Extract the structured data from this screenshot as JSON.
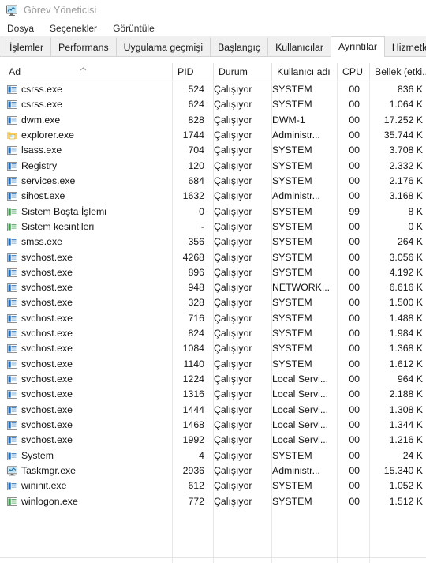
{
  "window": {
    "title": "Görev Yöneticisi",
    "icon": "taskmgr-chart-icon"
  },
  "menubar": {
    "items": [
      {
        "label": "Dosya"
      },
      {
        "label": "Seçenekler"
      },
      {
        "label": "Görüntüle"
      }
    ]
  },
  "tabs": [
    {
      "label": "İşlemler",
      "active": false
    },
    {
      "label": "Performans",
      "active": false
    },
    {
      "label": "Uygulama geçmişi",
      "active": false
    },
    {
      "label": "Başlangıç",
      "active": false
    },
    {
      "label": "Kullanıcılar",
      "active": false
    },
    {
      "label": "Ayrıntılar",
      "active": true
    },
    {
      "label": "Hizmetler",
      "active": false
    }
  ],
  "table": {
    "sort": {
      "column": "Ad",
      "direction": "ascending",
      "icon": "chevron-up-icon"
    },
    "columns": [
      {
        "key": "name",
        "label": "Ad",
        "align": "left"
      },
      {
        "key": "pid",
        "label": "PID",
        "align": "right"
      },
      {
        "key": "status",
        "label": "Durum",
        "align": "left"
      },
      {
        "key": "user",
        "label": "Kullanıcı adı",
        "align": "left"
      },
      {
        "key": "cpu",
        "label": "CPU",
        "align": "right"
      },
      {
        "key": "memory",
        "label": "Bellek (etki...",
        "align": "right"
      }
    ],
    "rows": [
      {
        "name": "csrss.exe",
        "pid": "524",
        "status": "Çalışıyor",
        "user": "SYSTEM",
        "cpu": "00",
        "memory": "836 K",
        "icon": "app-icon"
      },
      {
        "name": "csrss.exe",
        "pid": "624",
        "status": "Çalışıyor",
        "user": "SYSTEM",
        "cpu": "00",
        "memory": "1.064 K",
        "icon": "app-icon"
      },
      {
        "name": "dwm.exe",
        "pid": "828",
        "status": "Çalışıyor",
        "user": "DWM-1",
        "cpu": "00",
        "memory": "17.252 K",
        "icon": "app-icon"
      },
      {
        "name": "explorer.exe",
        "pid": "1744",
        "status": "Çalışıyor",
        "user": "Administr...",
        "cpu": "00",
        "memory": "35.744 K",
        "icon": "folder-icon"
      },
      {
        "name": "lsass.exe",
        "pid": "704",
        "status": "Çalışıyor",
        "user": "SYSTEM",
        "cpu": "00",
        "memory": "3.708 K",
        "icon": "app-icon"
      },
      {
        "name": "Registry",
        "pid": "120",
        "status": "Çalışıyor",
        "user": "SYSTEM",
        "cpu": "00",
        "memory": "2.332 K",
        "icon": "app-icon"
      },
      {
        "name": "services.exe",
        "pid": "684",
        "status": "Çalışıyor",
        "user": "SYSTEM",
        "cpu": "00",
        "memory": "2.176 K",
        "icon": "app-icon"
      },
      {
        "name": "sihost.exe",
        "pid": "1632",
        "status": "Çalışıyor",
        "user": "Administr...",
        "cpu": "00",
        "memory": "3.168 K",
        "icon": "app-icon"
      },
      {
        "name": "Sistem Boşta İşlemi",
        "pid": "0",
        "status": "Çalışıyor",
        "user": "SYSTEM",
        "cpu": "99",
        "memory": "8 K",
        "icon": "system-icon"
      },
      {
        "name": "Sistem kesintileri",
        "pid": "-",
        "status": "Çalışıyor",
        "user": "SYSTEM",
        "cpu": "00",
        "memory": "0 K",
        "icon": "system-icon"
      },
      {
        "name": "smss.exe",
        "pid": "356",
        "status": "Çalışıyor",
        "user": "SYSTEM",
        "cpu": "00",
        "memory": "264 K",
        "icon": "app-icon"
      },
      {
        "name": "svchost.exe",
        "pid": "4268",
        "status": "Çalışıyor",
        "user": "SYSTEM",
        "cpu": "00",
        "memory": "3.056 K",
        "icon": "app-icon"
      },
      {
        "name": "svchost.exe",
        "pid": "896",
        "status": "Çalışıyor",
        "user": "SYSTEM",
        "cpu": "00",
        "memory": "4.192 K",
        "icon": "app-icon"
      },
      {
        "name": "svchost.exe",
        "pid": "948",
        "status": "Çalışıyor",
        "user": "NETWORK...",
        "cpu": "00",
        "memory": "6.616 K",
        "icon": "app-icon"
      },
      {
        "name": "svchost.exe",
        "pid": "328",
        "status": "Çalışıyor",
        "user": "SYSTEM",
        "cpu": "00",
        "memory": "1.500 K",
        "icon": "app-icon"
      },
      {
        "name": "svchost.exe",
        "pid": "716",
        "status": "Çalışıyor",
        "user": "SYSTEM",
        "cpu": "00",
        "memory": "1.488 K",
        "icon": "app-icon"
      },
      {
        "name": "svchost.exe",
        "pid": "824",
        "status": "Çalışıyor",
        "user": "SYSTEM",
        "cpu": "00",
        "memory": "1.984 K",
        "icon": "app-icon"
      },
      {
        "name": "svchost.exe",
        "pid": "1084",
        "status": "Çalışıyor",
        "user": "SYSTEM",
        "cpu": "00",
        "memory": "1.368 K",
        "icon": "app-icon"
      },
      {
        "name": "svchost.exe",
        "pid": "1140",
        "status": "Çalışıyor",
        "user": "SYSTEM",
        "cpu": "00",
        "memory": "1.612 K",
        "icon": "app-icon"
      },
      {
        "name": "svchost.exe",
        "pid": "1224",
        "status": "Çalışıyor",
        "user": "Local Servi...",
        "cpu": "00",
        "memory": "964 K",
        "icon": "app-icon"
      },
      {
        "name": "svchost.exe",
        "pid": "1316",
        "status": "Çalışıyor",
        "user": "Local Servi...",
        "cpu": "00",
        "memory": "2.188 K",
        "icon": "app-icon"
      },
      {
        "name": "svchost.exe",
        "pid": "1444",
        "status": "Çalışıyor",
        "user": "Local Servi...",
        "cpu": "00",
        "memory": "1.308 K",
        "icon": "app-icon"
      },
      {
        "name": "svchost.exe",
        "pid": "1468",
        "status": "Çalışıyor",
        "user": "Local Servi...",
        "cpu": "00",
        "memory": "1.344 K",
        "icon": "app-icon"
      },
      {
        "name": "svchost.exe",
        "pid": "1992",
        "status": "Çalışıyor",
        "user": "Local Servi...",
        "cpu": "00",
        "memory": "1.216 K",
        "icon": "app-icon"
      },
      {
        "name": "System",
        "pid": "4",
        "status": "Çalışıyor",
        "user": "SYSTEM",
        "cpu": "00",
        "memory": "24 K",
        "icon": "app-icon"
      },
      {
        "name": "Taskmgr.exe",
        "pid": "2936",
        "status": "Çalışıyor",
        "user": "Administr...",
        "cpu": "00",
        "memory": "15.340 K",
        "icon": "taskmgr-icon"
      },
      {
        "name": "wininit.exe",
        "pid": "612",
        "status": "Çalışıyor",
        "user": "SYSTEM",
        "cpu": "00",
        "memory": "1.052 K",
        "icon": "app-icon"
      },
      {
        "name": "winlogon.exe",
        "pid": "772",
        "status": "Çalışıyor",
        "user": "SYSTEM",
        "cpu": "00",
        "memory": "1.512 K",
        "icon": "system-icon"
      }
    ]
  },
  "colors": {
    "accent_blue": "#1a6fc4",
    "accent_green": "#2f9b3f",
    "folder_yellow": "#ffc societies"
  }
}
